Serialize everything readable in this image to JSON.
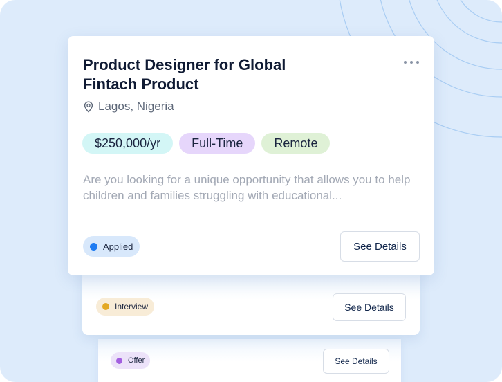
{
  "job": {
    "title_line1": "Product Designer for Global",
    "title_line2": "Fintach Product",
    "location": "Lagos, Nigeria",
    "tags": {
      "salary": "$250,000/yr",
      "type": "Full-Time",
      "work_mode": "Remote"
    },
    "description": "Are you looking for a unique opportunity that allows you to help children and families struggling with educational...",
    "status": "Applied",
    "action_label": "See Details",
    "more_icon": "more-horizontal-icon",
    "location_icon": "map-pin-icon"
  },
  "stacked_cards": [
    {
      "status": "Interview",
      "action_label": "See Details",
      "status_color": "#e3a823"
    },
    {
      "status": "Offer",
      "action_label": "See Details",
      "status_color": "#a35fe0"
    }
  ],
  "colors": {
    "background": "#ddebfb",
    "applied": "#1e7bf2",
    "tag_salary_bg": "#d3f6f6",
    "tag_type_bg": "#e6d6fb",
    "tag_remote_bg": "#dff1d6"
  }
}
